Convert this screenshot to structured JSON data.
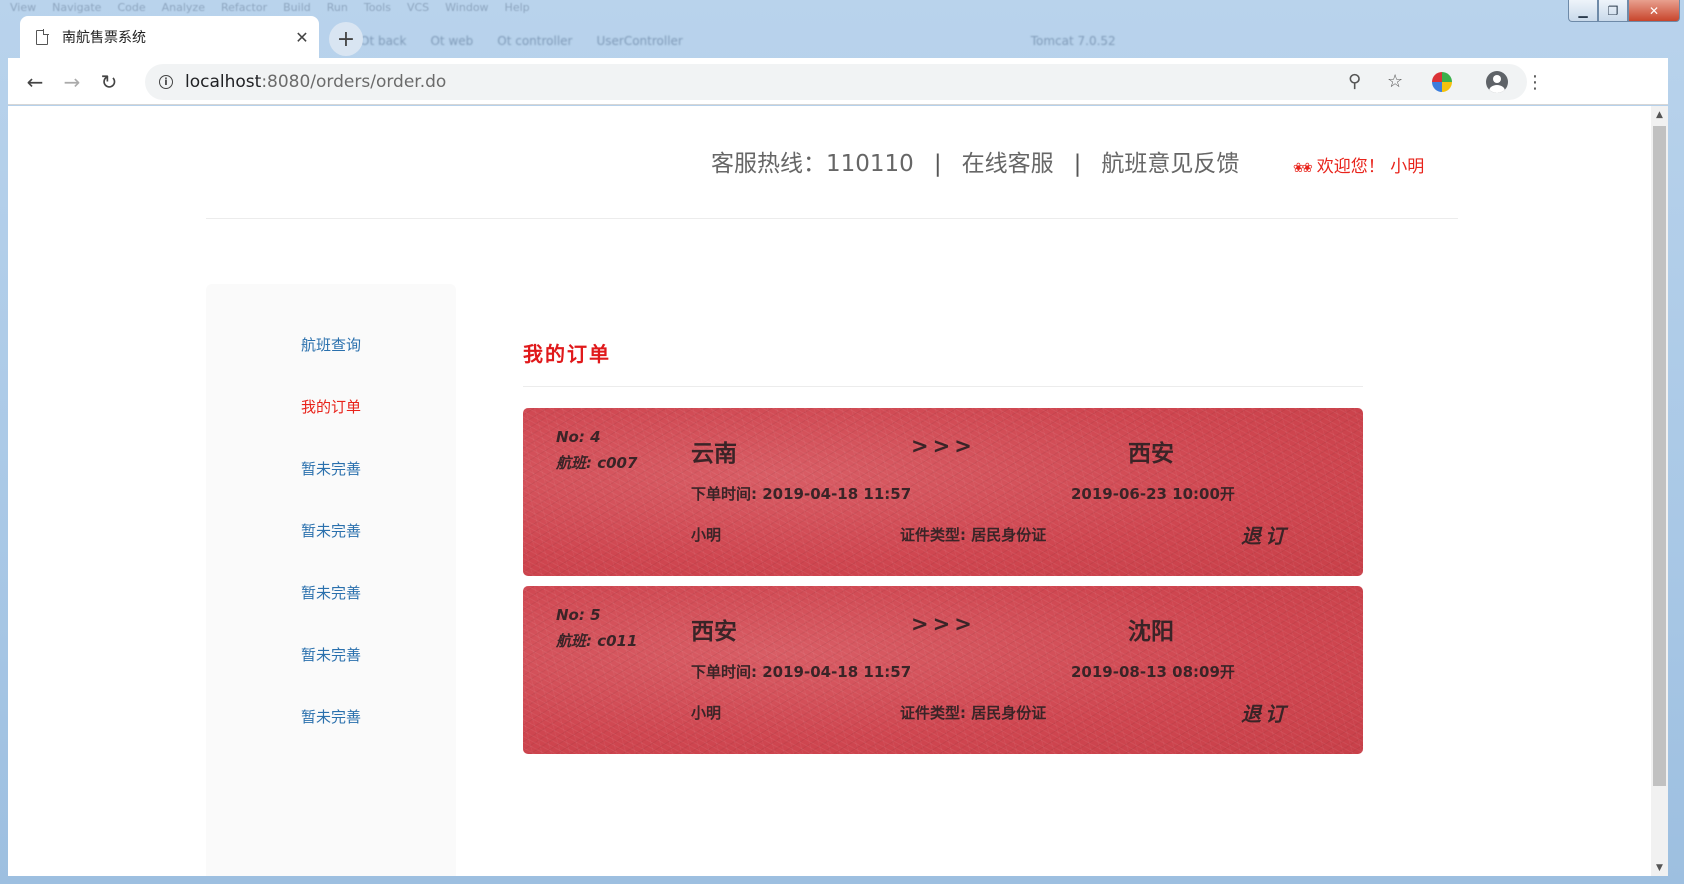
{
  "browser": {
    "tab_title": "南航售票系统",
    "tab_close": "✕",
    "new_tab": "+",
    "url_host": "localhost",
    "url_rest": ":8080/orders/order.do"
  },
  "site": {
    "hotline": "客服热线：110110",
    "sep": "|",
    "online_service": "在线客服",
    "feedback": "航班意见反馈",
    "welcome_flower": "❀❀",
    "welcome": "欢迎您！ 小明"
  },
  "sidebar": {
    "items": [
      {
        "label": "航班查询",
        "active": false
      },
      {
        "label": "我的订单",
        "active": true
      },
      {
        "label": "暂未完善",
        "active": false
      },
      {
        "label": "暂未完善",
        "active": false
      },
      {
        "label": "暂未完善",
        "active": false
      },
      {
        "label": "暂未完善",
        "active": false
      },
      {
        "label": "暂未完善",
        "active": false
      }
    ]
  },
  "main": {
    "title": "我的订单",
    "orders": [
      {
        "no": "No: 4",
        "flight": "航班: c007",
        "from": "云南",
        "arrows": ">>>",
        "to": "西安",
        "order_time": "下单时间: 2019-04-18 11:57",
        "depart": "2019-06-23 10:00开",
        "passenger": "小明",
        "id_type": "证件类型: 居民身份证",
        "refund": "退订"
      },
      {
        "no": "No: 5",
        "flight": "航班: c011",
        "from": "西安",
        "arrows": ">>>",
        "to": "沈阳",
        "order_time": "下单时间: 2019-04-18 11:57",
        "depart": "2019-08-13 08:09开",
        "passenger": "小明",
        "id_type": "证件类型: 居民身份证",
        "refund": "退订"
      }
    ]
  },
  "colors": {
    "accent_red": "#e8231b",
    "link_blue": "#2a70ad",
    "ticket_red": "#d04a52"
  }
}
